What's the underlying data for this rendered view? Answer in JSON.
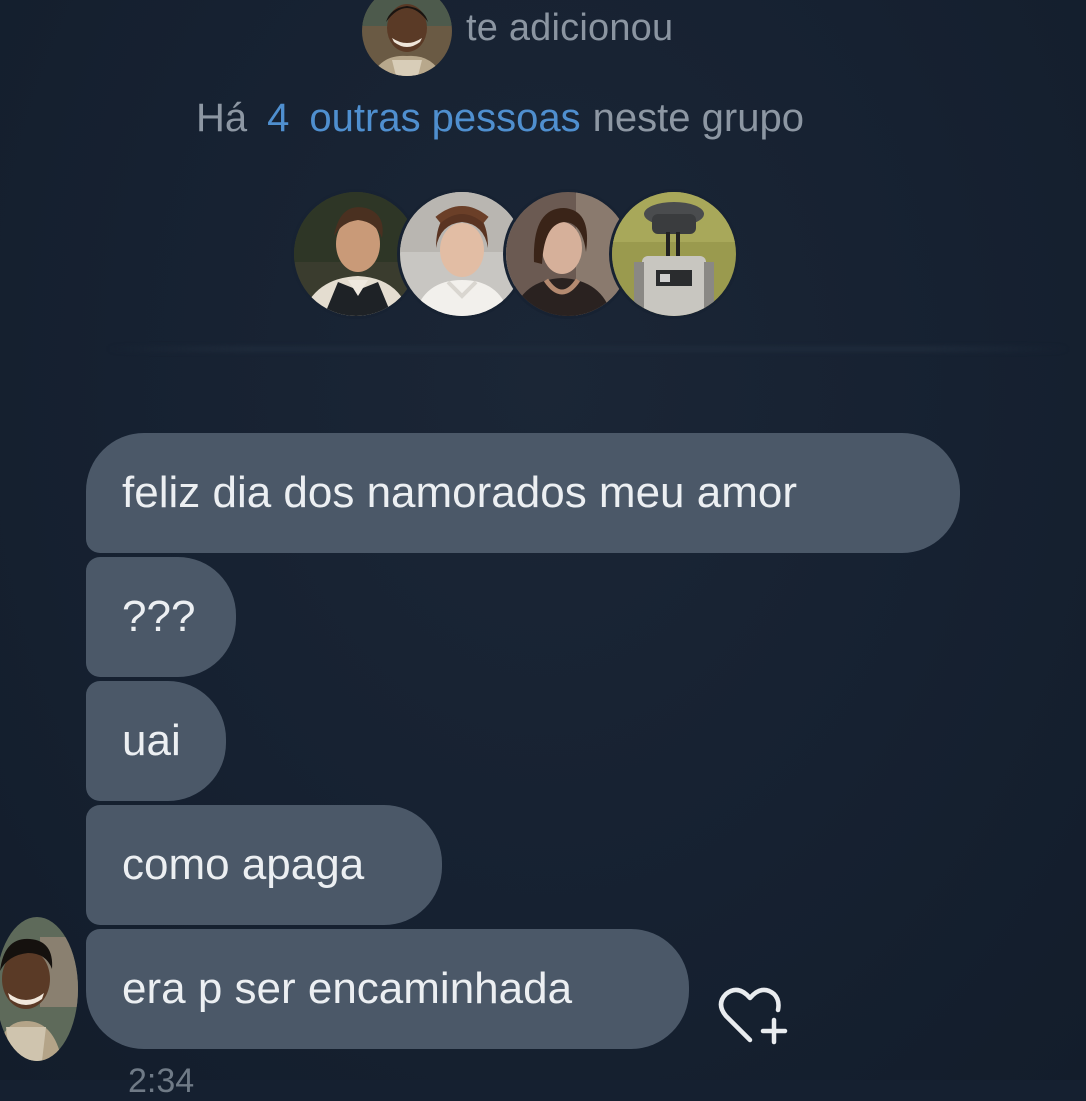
{
  "system": {
    "added_text": "te adicionou",
    "info_prefix": "Há",
    "info_count": "4",
    "info_link": "outras pessoas",
    "info_suffix": "neste grupo"
  },
  "members": [
    {
      "name": "member-han"
    },
    {
      "name": "member-leia"
    },
    {
      "name": "member-qira"
    },
    {
      "name": "member-droid"
    }
  ],
  "messages": [
    {
      "text": "feliz dia dos namorados meu amor"
    },
    {
      "text": "???"
    },
    {
      "text": "uai"
    },
    {
      "text": "como apaga"
    },
    {
      "text": "era p ser encaminhada"
    }
  ],
  "footer": {
    "timestamp": "2:34"
  },
  "colors": {
    "background": "#162131",
    "bubble": "#4b5868",
    "link": "#4f8fcf",
    "muted_text": "#8d97a3"
  },
  "icons": {
    "react": "heart-plus-icon"
  }
}
